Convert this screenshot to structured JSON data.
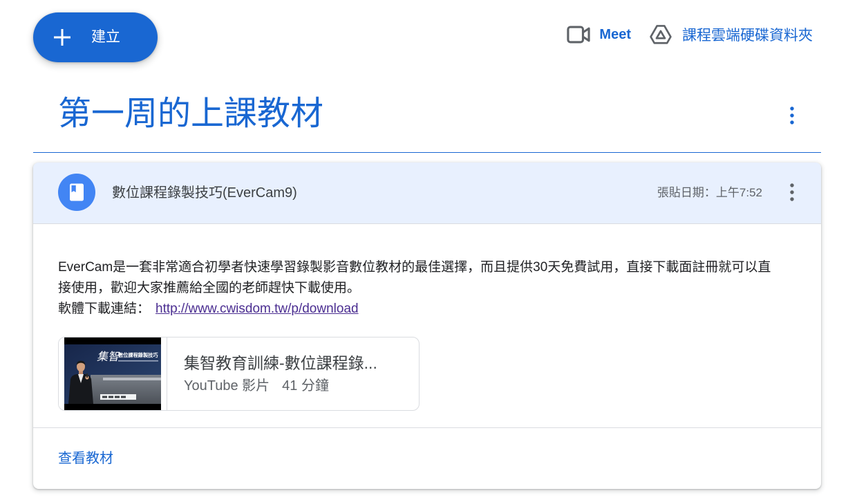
{
  "header": {
    "create_label": "建立",
    "meet_label": "Meet",
    "drive_folder_label": "課程雲端硬碟資料夾"
  },
  "topic": {
    "title": "第一周的上課教材"
  },
  "material": {
    "title": "數位課程錄製技巧(EverCam9)",
    "posted_date": "張貼日期：上午7:52",
    "description": "EverCam是一套非常適合初學者快速學習錄製影音數位教材的最佳選擇，而且提供30天免費試用，直接下載面註冊就可以直接使用，歡迎大家推薦給全國的老師趕快下載使用。",
    "download_label": "軟體下載連結：",
    "download_link": "http://www.cwisdom.tw/p/download",
    "attachment": {
      "title": "集智教育訓練-數位課程錄...",
      "type": "YouTube 影片",
      "duration": "41 分鐘",
      "thumbnail_logo": "集智",
      "thumbnail_caption": "數位課程錄製技巧"
    },
    "view_label": "查看教材"
  },
  "icons": {
    "create": "plus-icon",
    "meet": "video-camera-icon",
    "drive_folder": "drive-icon",
    "material": "book-icon",
    "more": "more-vert-icon"
  },
  "colors": {
    "primary": "#1967d2",
    "icon_bg": "#4285f4",
    "header_bg": "#e8f0fe",
    "link": "#4b2e91",
    "text": "#3c4043",
    "secondary": "#5f6368",
    "divider": "#dadce0"
  }
}
